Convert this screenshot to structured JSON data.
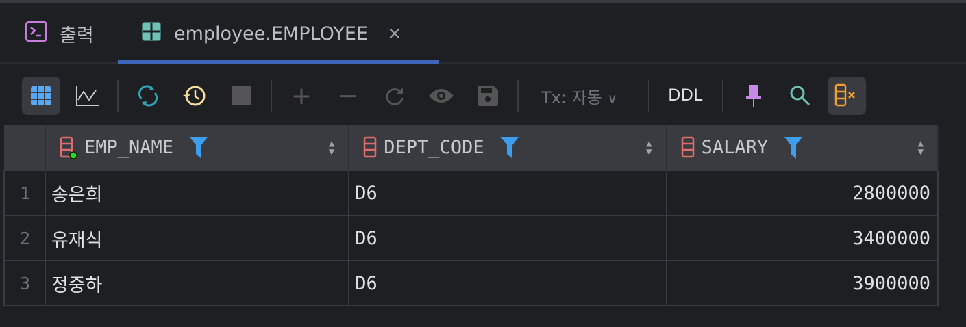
{
  "tabs": [
    {
      "label": "출력",
      "icon": "console-icon"
    },
    {
      "label": "employee.EMPLOYEE",
      "icon": "table-icon",
      "active": true
    }
  ],
  "toolbar": {
    "tx_label": "Tx: 자동",
    "ddl_label": "DDL"
  },
  "table": {
    "columns": [
      "EMP_NAME",
      "DEPT_CODE",
      "SALARY"
    ],
    "rows": [
      {
        "n": "1",
        "EMP_NAME": "송은희",
        "DEPT_CODE": "D6",
        "SALARY": "2800000"
      },
      {
        "n": "2",
        "EMP_NAME": "유재식",
        "DEPT_CODE": "D6",
        "SALARY": "3400000"
      },
      {
        "n": "3",
        "EMP_NAME": "정중하",
        "DEPT_CODE": "D6",
        "SALARY": "3900000"
      }
    ]
  },
  "colors": {
    "accent": "#3d66bb",
    "filter": "#3d9ef0",
    "column_icon": "#e06c6c"
  }
}
